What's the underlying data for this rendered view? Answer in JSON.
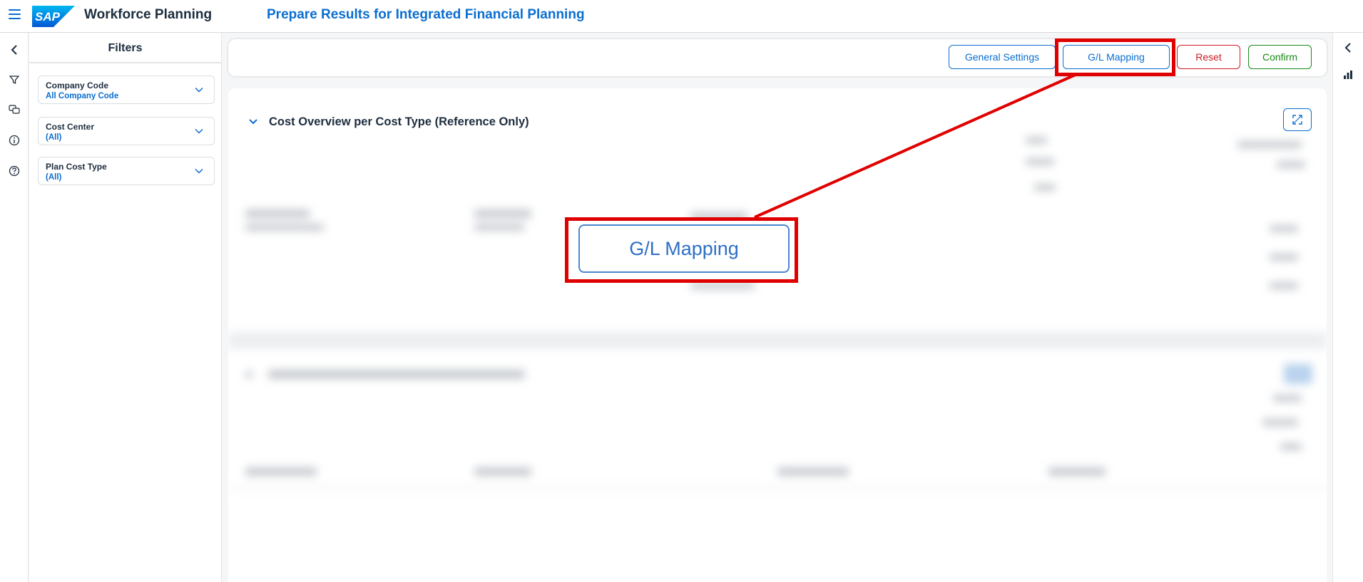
{
  "shell": {
    "menu_icon": "hamburger-menu-icon",
    "logo_text": "SAP",
    "app_title": "Workforce Planning",
    "page_title": "Prepare Results for Integrated Financial Planning"
  },
  "left_rail": {
    "icons": [
      "collapse-left-icon",
      "filter-icon",
      "comments-icon",
      "info-icon",
      "help-icon"
    ]
  },
  "filters": {
    "title": "Filters",
    "fields": [
      {
        "label": "Company Code",
        "value": "All Company Code"
      },
      {
        "label": "Cost Center",
        "value": "(All)"
      },
      {
        "label": "Plan Cost Type",
        "value": "(All)"
      }
    ]
  },
  "toolbar": {
    "general_settings": "General Settings",
    "gl_mapping": "G/L Mapping",
    "reset": "Reset",
    "confirm": "Confirm"
  },
  "section": {
    "title": "Cost Overview per Cost Type (Reference Only)",
    "fullscreen_icon": "fullscreen-icon"
  },
  "highlight": {
    "zoomed_label": "G/L Mapping",
    "color": "#e00000"
  },
  "right_rail": {
    "icons": [
      "collapse-right-icon",
      "chart-icon"
    ]
  },
  "colors": {
    "accent": "#0a6ed1",
    "reject": "#d01c24",
    "accept": "#188918"
  }
}
